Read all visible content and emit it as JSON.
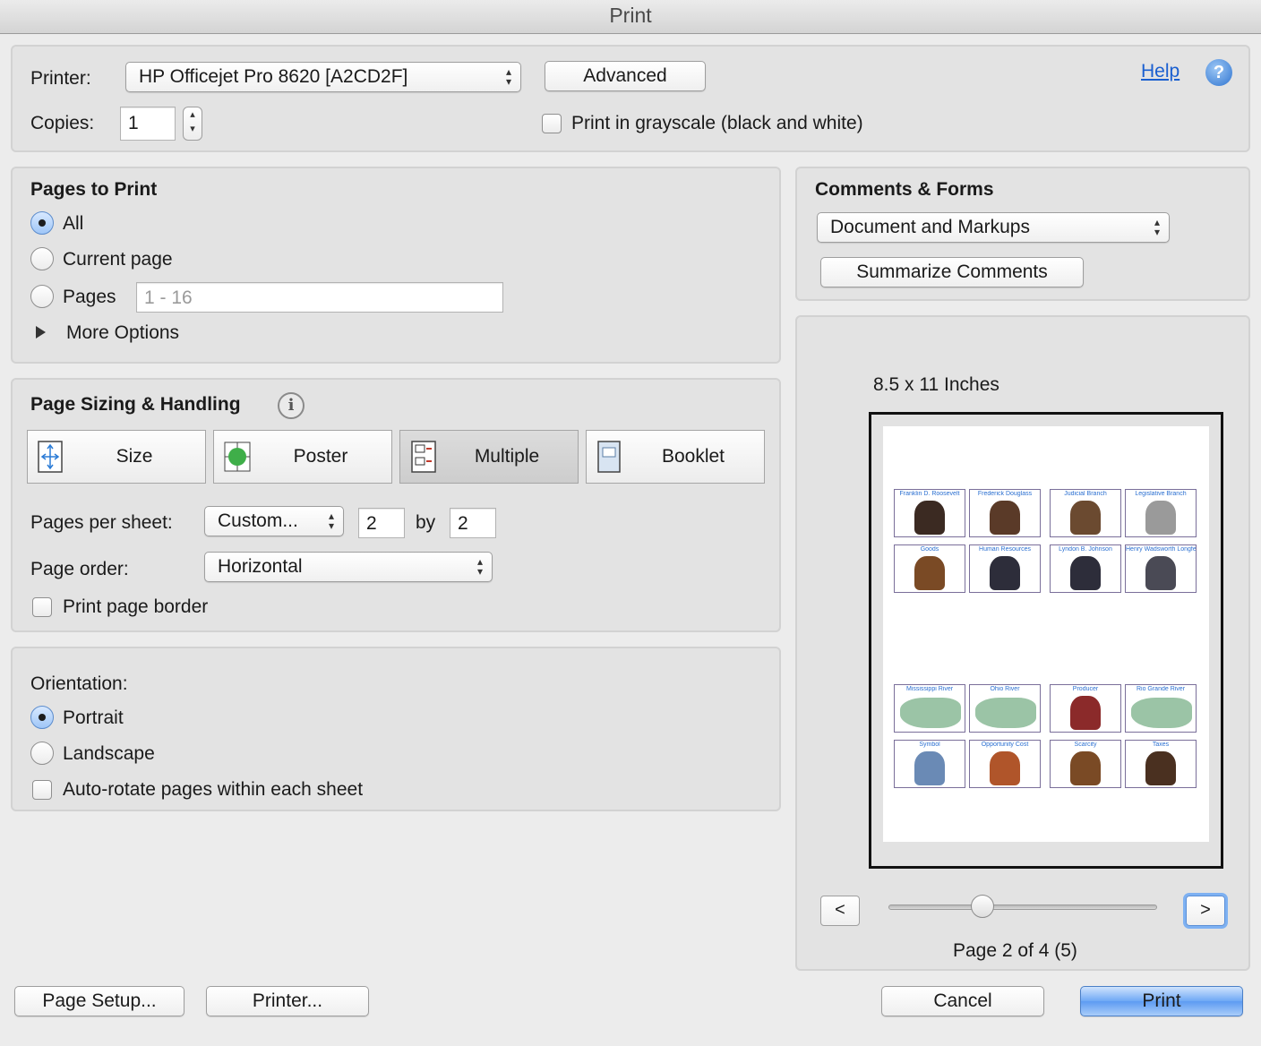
{
  "window": {
    "title": "Print"
  },
  "printer": {
    "label": "Printer:",
    "selected": "HP Officejet Pro 8620 [A2CD2F]",
    "advanced_button": "Advanced",
    "help_link": "Help",
    "help_icon": "question-icon"
  },
  "copies": {
    "label": "Copies:",
    "value": "1"
  },
  "grayscale": {
    "label": "Print in grayscale (black and white)",
    "checked": false
  },
  "pages_to_print": {
    "heading": "Pages to Print",
    "options": [
      {
        "label": "All",
        "selected": true
      },
      {
        "label": "Current page",
        "selected": false
      },
      {
        "label": "Pages",
        "selected": false
      }
    ],
    "pages_range_placeholder": "1 - 16",
    "more_options": "More Options"
  },
  "page_sizing": {
    "heading": "Page Sizing & Handling",
    "info_icon": "info-icon",
    "modes": [
      {
        "label": "Size",
        "icon": "size-icon",
        "active": false
      },
      {
        "label": "Poster",
        "icon": "poster-icon",
        "active": false
      },
      {
        "label": "Multiple",
        "icon": "multiple-icon",
        "active": true
      },
      {
        "label": "Booklet",
        "icon": "booklet-icon",
        "active": false
      }
    ],
    "pages_per_sheet_label": "Pages per sheet:",
    "pages_per_sheet_value": "Custom...",
    "cols_value": "2",
    "by_label": "by",
    "rows_value": "2",
    "page_order_label": "Page order:",
    "page_order_value": "Horizontal",
    "print_border_label": "Print page border"
  },
  "orientation": {
    "heading": "Orientation:",
    "options": [
      {
        "label": "Portrait",
        "selected": true
      },
      {
        "label": "Landscape",
        "selected": false
      }
    ],
    "auto_rotate_label": "Auto-rotate pages within each sheet"
  },
  "comments_forms": {
    "heading": "Comments & Forms",
    "selected": "Document and Markups",
    "summarize_button": "Summarize Comments"
  },
  "preview": {
    "paper_size": "8.5 x 11 Inches",
    "thumbnails": [
      "Franklin D. Roosevelt",
      "Frederick Douglass",
      "Judicial Branch",
      "Legislative Branch",
      "Goods",
      "Human Resources",
      "Lyndon B. Johnson",
      "Henry Wadsworth Longfellow",
      "Mississippi River",
      "Ohio River",
      "Producer",
      "Rio Grande River",
      "Symbol",
      "Opportunity Cost",
      "Scarcity",
      "Taxes"
    ],
    "prev_label": "<",
    "next_label": ">",
    "page_status": "Page 2 of 4 (5)",
    "slider_position": 0.35
  },
  "footer": {
    "page_setup": "Page Setup...",
    "printer": "Printer...",
    "cancel": "Cancel",
    "print": "Print"
  },
  "colors": {
    "accent": "#5d9bf2",
    "link": "#1a5fd0",
    "thumb_caption": "#2a6fd1"
  }
}
